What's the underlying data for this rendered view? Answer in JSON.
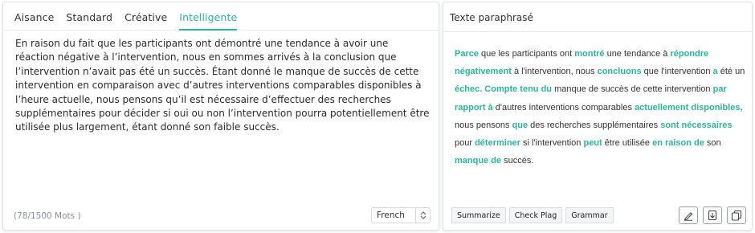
{
  "tabs": [
    {
      "label": "Aisance"
    },
    {
      "label": "Standard"
    },
    {
      "label": "Créative"
    },
    {
      "label": "Intelligente"
    }
  ],
  "source": {
    "text": "En raison du fait que les participants ont démontré une tendance à avoir une réaction négative à l’intervention, nous en sommes arrivés à la conclusion que l’intervention n’avait pas été un succès. Étant donné le manque de succès de cette intervention en comparaison avec d’autres interventions comparables disponibles à l’heure actuelle, nous pensons qu’il est nécessaire d’effectuer des recherches supplémentaires pour décider si oui ou non l’intervention pourra potentiellement être utilisée plus largement, étant donné son faible succès.",
    "word_count": "(78/1500 Mots )",
    "language": "French"
  },
  "result": {
    "header": "Texte paraphrasé",
    "segments": [
      {
        "t": "Parce",
        "hl": true
      },
      {
        "t": " que les participants ont ",
        "hl": false
      },
      {
        "t": "montré",
        "hl": true
      },
      {
        "t": " une tendance à ",
        "hl": false
      },
      {
        "t": "répondre négativement",
        "hl": true
      },
      {
        "t": " à l'intervention, nous ",
        "hl": false
      },
      {
        "t": "concluons",
        "hl": true
      },
      {
        "t": " que l'intervention ",
        "hl": false
      },
      {
        "t": "a",
        "hl": true
      },
      {
        "t": " été un ",
        "hl": false
      },
      {
        "t": "échec. Compte tenu du",
        "hl": true
      },
      {
        "t": " manque de succès de cette intervention ",
        "hl": false
      },
      {
        "t": "par rapport à",
        "hl": true
      },
      {
        "t": " d'autres interventions comparables ",
        "hl": false
      },
      {
        "t": "actuellement disponibles,",
        "hl": true
      },
      {
        "t": " nous pensons ",
        "hl": false
      },
      {
        "t": "que",
        "hl": true
      },
      {
        "t": " des recherches supplémentaires ",
        "hl": false
      },
      {
        "t": "sont nécessaires",
        "hl": true
      },
      {
        "t": " pour ",
        "hl": false
      },
      {
        "t": "déterminer",
        "hl": true
      },
      {
        "t": " si l'intervention ",
        "hl": false
      },
      {
        "t": "peut",
        "hl": true
      },
      {
        "t": " être utilisée ",
        "hl": false
      },
      {
        "t": "en raison de",
        "hl": true
      },
      {
        "t": " son ",
        "hl": false
      },
      {
        "t": "manque de",
        "hl": true
      },
      {
        "t": " succès.",
        "hl": false
      }
    ],
    "buttons": {
      "summarize": "Summarize",
      "check_plag": "Check Plag",
      "grammar": "Grammar"
    },
    "icons": [
      "pen-icon",
      "download-icon",
      "copy-icon"
    ]
  },
  "colors": {
    "accent": "#2bb59a"
  }
}
